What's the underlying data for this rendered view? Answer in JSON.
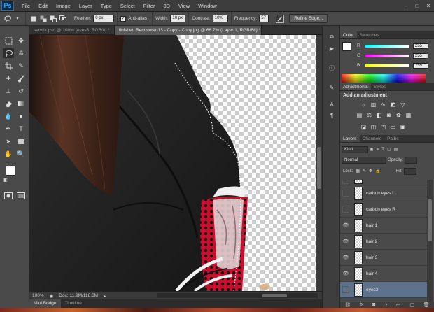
{
  "app": {
    "logo": "Ps"
  },
  "menu": [
    "File",
    "Edit",
    "Image",
    "Layer",
    "Type",
    "Select",
    "Filter",
    "3D",
    "View",
    "Window"
  ],
  "window_controls": [
    "–",
    "□",
    "✕"
  ],
  "options": {
    "feather_label": "Feather:",
    "feather_value": "0 px",
    "antialias_label": "Anti-alias",
    "width_label": "Width:",
    "width_value": "10 px",
    "contrast_label": "Contrast:",
    "contrast_value": "10%",
    "frequency_label": "Frequency:",
    "frequency_value": "57",
    "refine_label": "Refine Edge..."
  },
  "tabs": [
    {
      "label": "semfix.psd @ 100% (eyes3, RGB/8) *",
      "active": false
    },
    {
      "label": "finished Recovered13 - Copy - Copy.jpg @ 66.7% (Layer 1, RGB/8#) *",
      "active": true
    }
  ],
  "status": {
    "zoom": "100%",
    "doc": "Doc: 11.9M/118.6M"
  },
  "bottom_tabs": [
    "Mini Bridge",
    "Timeline"
  ],
  "color_panel": {
    "tabs": [
      "Color",
      "Swatches"
    ],
    "r": "255",
    "g": "255",
    "b": "255",
    "r_label": "R",
    "g_label": "G",
    "b_label": "B"
  },
  "adjustments": {
    "tabs": [
      "Adjustments",
      "Styles"
    ],
    "title": "Add an adjustment"
  },
  "layers": {
    "tabs": [
      "Layers",
      "Channels",
      "Paths"
    ],
    "kind": "Kind",
    "blend": "Normal",
    "opacity_label": "Opacity:",
    "lock_label": "Lock:",
    "fill_label": "Fill:",
    "items": [
      {
        "name": "carbon eyes L",
        "visible": false,
        "selected": false
      },
      {
        "name": "carbon eyes R",
        "visible": false,
        "selected": false
      },
      {
        "name": "hair 1",
        "visible": true,
        "selected": false
      },
      {
        "name": "hair 2",
        "visible": true,
        "selected": false
      },
      {
        "name": "hair 3",
        "visible": true,
        "selected": false
      },
      {
        "name": "hair 4",
        "visible": true,
        "selected": false
      },
      {
        "name": "eyes3",
        "visible": false,
        "selected": true
      }
    ]
  }
}
